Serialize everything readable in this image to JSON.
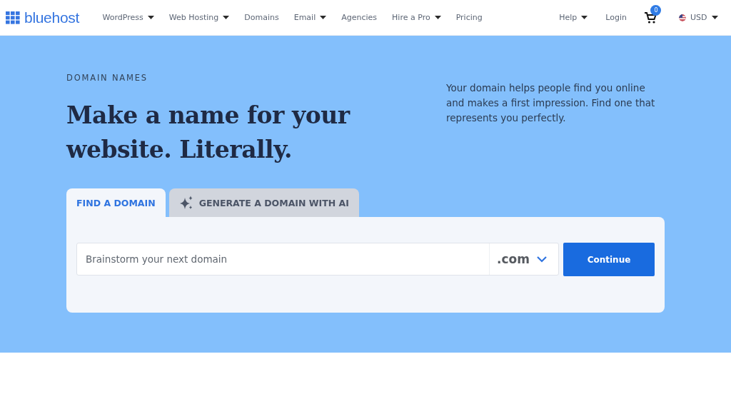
{
  "header": {
    "logo": "bluehost",
    "nav": [
      {
        "label": "WordPress",
        "dropdown": true
      },
      {
        "label": "Web Hosting",
        "dropdown": true
      },
      {
        "label": "Domains",
        "dropdown": false
      },
      {
        "label": "Email",
        "dropdown": true
      },
      {
        "label": "Agencies",
        "dropdown": false
      },
      {
        "label": "Hire a Pro",
        "dropdown": true
      },
      {
        "label": "Pricing",
        "dropdown": false
      }
    ],
    "help": "Help",
    "login": "Login",
    "cart_count": "0",
    "currency": "USD"
  },
  "hero": {
    "eyebrow": "DOMAIN NAMES",
    "title": "Make a name for your website. Literally.",
    "description": "Your domain helps people find you online and makes a first impression. Find one that represents you perfectly.",
    "tabs": [
      {
        "label": "FIND A DOMAIN",
        "selected": true,
        "kind": "plain"
      },
      {
        "label": "GENERATE A DOMAIN WITH AI",
        "selected": false,
        "kind": "ai"
      }
    ],
    "search": {
      "placeholder": "Brainstorm your next domain",
      "tld": ".com",
      "button": "Continue"
    }
  }
}
